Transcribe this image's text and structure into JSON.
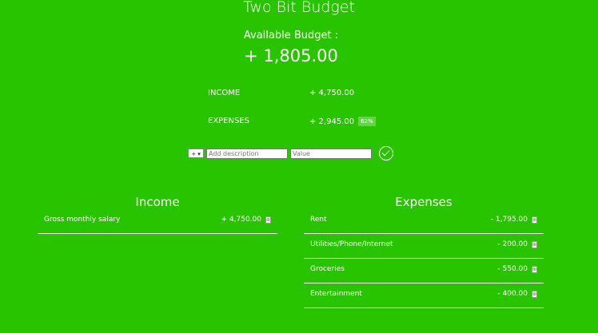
{
  "app": {
    "title": "Two Bit Budget"
  },
  "budget": {
    "available_label": "Available Budget :",
    "available_value": "+ 1,805.00"
  },
  "summary": {
    "income_label": "INCOME",
    "income_value": "+ 4,750.00",
    "expenses_label": "EXPENSES",
    "expenses_value": "+ 2,945.00",
    "expenses_percent": "62%"
  },
  "add_form": {
    "type_value": "+ ▾",
    "description_placeholder": "Add description",
    "value_placeholder": "Value"
  },
  "income": {
    "title": "Income",
    "items": [
      {
        "description": "Gross monthly salary",
        "value": "+ 4,750.00"
      }
    ]
  },
  "expenses": {
    "title": "Expenses",
    "items": [
      {
        "description": "Rent",
        "value": "- 1,795.00"
      },
      {
        "description": "Utilities/Phone/Internet",
        "value": "- 200.00"
      },
      {
        "description": "Groceries",
        "value": "- 550.00"
      },
      {
        "description": "Entertainment",
        "value": "- 400.00"
      }
    ]
  },
  "icons": {
    "delete": "delete-icon",
    "add": "checkmark-circle-icon"
  },
  "colors": {
    "background": "#28c400",
    "text": "#ffffff"
  }
}
